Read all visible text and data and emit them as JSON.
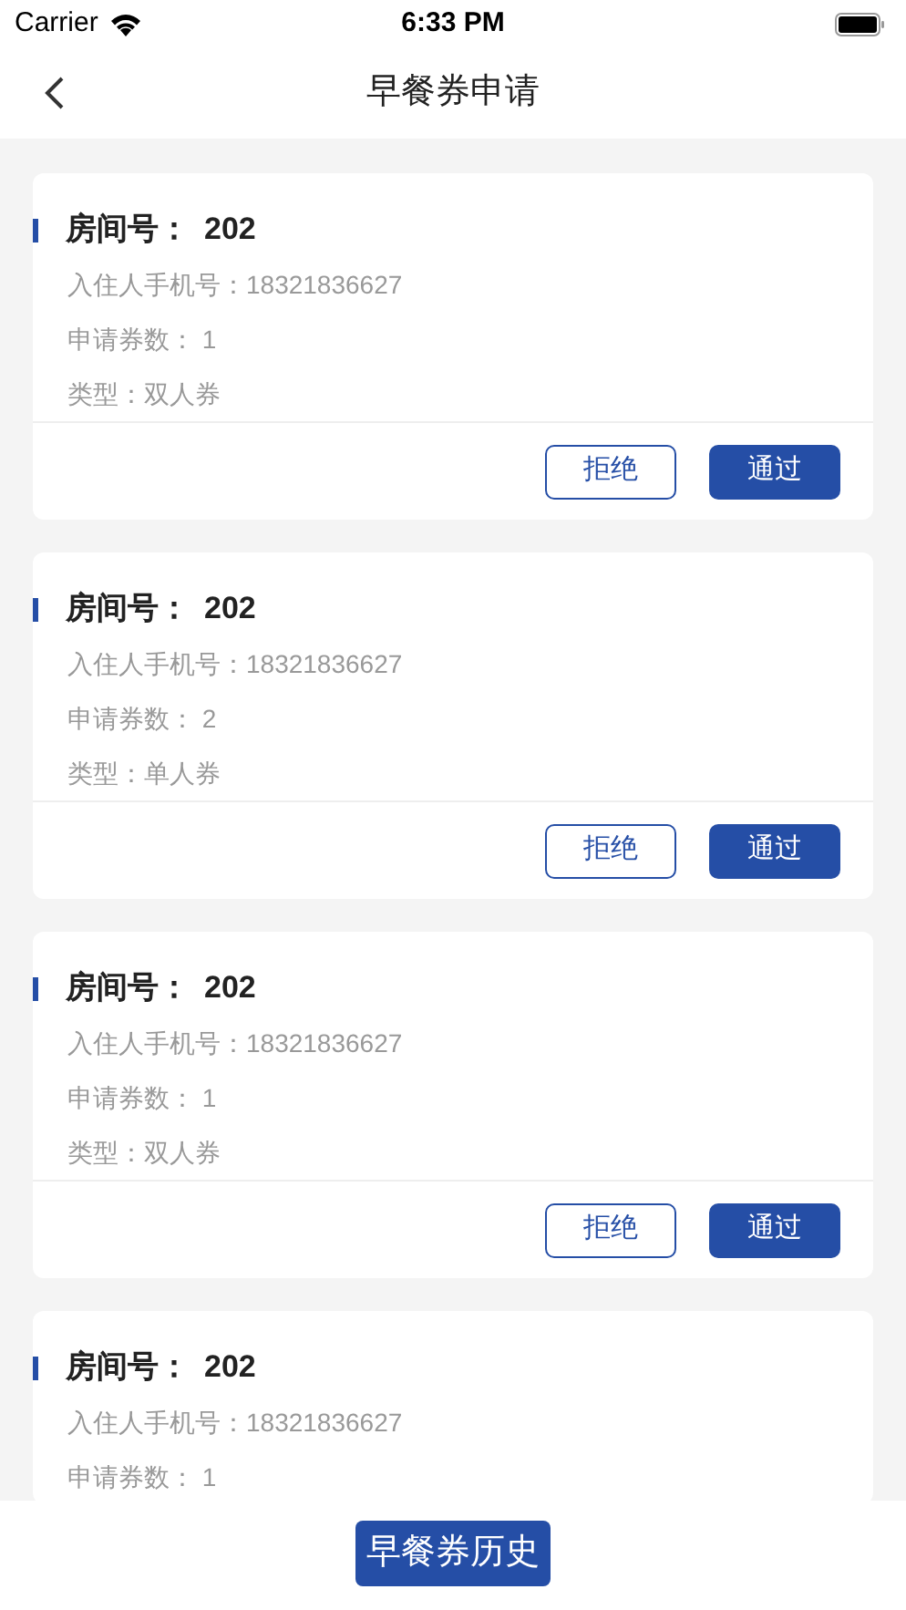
{
  "status_bar": {
    "carrier": "Carrier",
    "time": "6:33 PM"
  },
  "nav": {
    "title": "早餐券申请"
  },
  "cards": [
    {
      "room_label": "房间号：",
      "room": "202",
      "lines": [
        "入住人手机号：18321836627",
        "申请券数： 1",
        "类型：双人券"
      ],
      "buttons": [
        {
          "kind": "outline",
          "label": "拒绝"
        },
        {
          "kind": "filled",
          "label": "通过"
        }
      ]
    },
    {
      "room_label": "房间号：",
      "room": "202",
      "lines": [
        "入住人手机号：18321836627",
        "申请券数： 2",
        "类型：单人券"
      ],
      "buttons": [
        {
          "kind": "outline",
          "label": "拒绝"
        },
        {
          "kind": "filled",
          "label": "通过"
        }
      ]
    },
    {
      "room_label": "房间号：",
      "room": "202",
      "lines": [
        "入住人手机号：18321836627",
        "申请券数： 1",
        "类型：双人券"
      ],
      "buttons": [
        {
          "kind": "outline",
          "label": "拒绝"
        },
        {
          "kind": "filled",
          "label": "通过"
        }
      ]
    },
    {
      "room_label": "房间号：",
      "room": "202",
      "lines": [
        "入住人手机号：18321836627",
        "申请券数： 1"
      ]
    }
  ],
  "bottom_button": "早餐券历史"
}
